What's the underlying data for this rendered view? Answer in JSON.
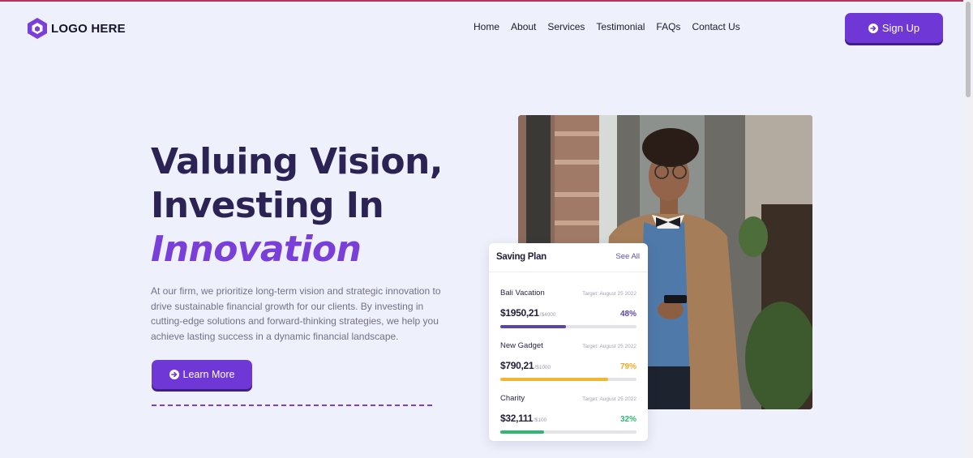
{
  "brand": {
    "logo_text": "LOGO HERE"
  },
  "nav": {
    "items": [
      "Home",
      "About",
      "Services",
      "Testimonial",
      "FAQs",
      "Contact Us"
    ]
  },
  "header": {
    "signup_label": "Sign Up"
  },
  "hero": {
    "title_line1": "Valuing Vision,",
    "title_line2": "Investing In",
    "title_accent": "Innovation",
    "description": "At our firm, we prioritize long-term vision and strategic innovation to drive sustainable financial growth for our clients. By investing in cutting-edge solutions and forward-thinking strategies, we help you achieve lasting success in a dynamic financial landscape.",
    "cta_label": "Learn More"
  },
  "saving_plan": {
    "title": "Saving Plan",
    "see_all": "See All",
    "plans": [
      {
        "name": "Bali Vacation",
        "target": "Target: August 25 2022",
        "amount": "$1950,21",
        "of": "/$4000",
        "percent": "48%",
        "progress": 0.48,
        "color": "#5a46a8"
      },
      {
        "name": "New Gadget",
        "target": "Target: August 25 2022",
        "amount": "$790,21",
        "of": "/$1000",
        "percent": "79%",
        "progress": 0.79,
        "color": "#f2b632"
      },
      {
        "name": "Charity",
        "target": "Target: August 25 2022",
        "amount": "$32,111",
        "of": "/$100",
        "percent": "32%",
        "progress": 0.32,
        "color": "#2eb872"
      }
    ]
  },
  "colors": {
    "accent": "#6e37d6",
    "title": "#2c2355"
  }
}
